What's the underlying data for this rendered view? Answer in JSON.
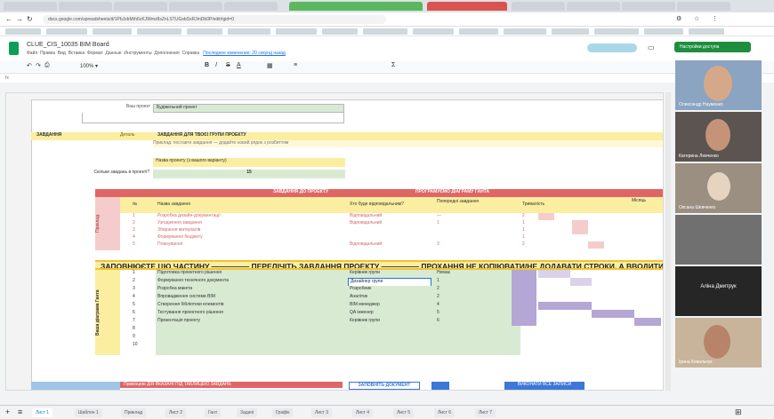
{
  "browser": {
    "url": "docs.google.com/spreadsheets/d/1PbJxbMrh6cKJWmz8sZnLSTUGsbSxRJmDb0P/edit#gid=0",
    "window_title": "Google Sheets"
  },
  "doc": {
    "title": "CLUE_CIS_10035 BIM Board",
    "menu": [
      "Файл",
      "Правка",
      "Вид",
      "Вставка",
      "Формат",
      "Данные",
      "Инструменты",
      "Дополнения",
      "Справка"
    ],
    "menu_note": "Последнее изменение: 20 секунд назад",
    "cell_ref": "",
    "share_label": "Настройки доступа"
  },
  "sheet": {
    "top_label": "Ваш проект",
    "top_value": "Будівельний проект",
    "section_label": "ЗАВДАННЯ",
    "section_note": "Деталь",
    "section_header": "ЗАВДАННЯ ДЛЯ ТВОЄЇ ГРУПИ ПРОЕКТУ",
    "section_sub": "Приклад: поставте завдання — додайте новий рядок з розбиттям",
    "prompt_label": "Назва проекту (з вашого варіанту)",
    "metric_label": "Скільки завдань в проекті?",
    "metric_value": "15",
    "red_header_left": "ЗАВДАННЯ ДО ПРОЕКТУ",
    "red_header_right": "ПРОГРАМУЄМО ДІАГРАМУ ГАНТА",
    "table_headers": [
      "№",
      "Назва завдання",
      "Хто буде відповідальним?",
      "Попередні завдання",
      "Тривалість",
      "Місяць"
    ],
    "example_label": "Приклад",
    "example_rows": [
      {
        "n": "1",
        "task": "Розробка дизайн-документації",
        "owner": "Відповідальний",
        "dep": "—",
        "dur": "2"
      },
      {
        "n": "2",
        "task": "Узгодження завдання",
        "owner": "Відповідальний",
        "dep": "1",
        "dur": "1"
      },
      {
        "n": "3",
        "task": "Збирання матеріалів",
        "owner": "",
        "dep": "",
        "dur": "1"
      },
      {
        "n": "4",
        "task": "Формування бюджету",
        "owner": "",
        "dep": "",
        "dur": "1"
      },
      {
        "n": "5",
        "task": "Планування",
        "owner": "Відповідальний",
        "dep": "3",
        "dur": "2"
      }
    ],
    "yellow_banner": "ЗАПОВНЮЄТЕ ЦЮ ЧАСТИНУ ————— ПЕРЕЛІЧІТЬ ЗАВДАННЯ ПРОЕКТУ ————— ПРОХАННЯ НЕ КОПІЮВАТИ/НЕ ДОДАВАТИ СТРОКИ. А ВВОДИТИ",
    "main_label": "Ваша діаграма Ганта",
    "main_rows": [
      {
        "n": "1",
        "task": "Підготовка проектного рішення",
        "owner": "Керівник групи",
        "dep": "Немає",
        "dur": "3"
      },
      {
        "n": "2",
        "task": "Формування технічного документа",
        "owner": "Дизайнер групи",
        "dep": "1",
        "dur": "2"
      },
      {
        "n": "3",
        "task": "Розробка макета",
        "owner": "Розробник",
        "dep": "2",
        "dur": "4"
      },
      {
        "n": "4",
        "task": "Впровадження системи BIM",
        "owner": "Аналітик",
        "dep": "2",
        "dur": "2"
      },
      {
        "n": "5",
        "task": "Створення бібліотеки елементів",
        "owner": "BIM менеджер",
        "dep": "4",
        "dur": "3"
      },
      {
        "n": "6",
        "task": "Тестування проектного рішення",
        "owner": "QA інженер",
        "dep": "5",
        "dur": "2"
      },
      {
        "n": "7",
        "task": "Презентація проекту",
        "owner": "Керівник групи",
        "dep": "6",
        "dur": "1"
      },
      {
        "n": "8",
        "task": "",
        "owner": "",
        "dep": "",
        "dur": ""
      },
      {
        "n": "9",
        "task": "",
        "owner": "",
        "dep": "",
        "dur": ""
      },
      {
        "n": "10",
        "task": "",
        "owner": "",
        "dep": "",
        "dur": ""
      }
    ],
    "bottom_left": "Прикінцеві ДІЯ ВКАЗАНІ ПІД ТАБЛИЦЕЮ ЗАВДАНЬ",
    "bottom_btn1": "ЗАПОВНІТЬ ДОКУМЕНТ",
    "bottom_btn2": "ВИКОНАТИ ВСЕ ЗАПИСИ"
  },
  "sheet_tabs": [
    "Лист 1",
    "Шаблон 1",
    "Приклад",
    "Лист 2",
    "Гант",
    "Задачі",
    "Графік",
    "Лист 3",
    "Лист 4",
    "Лист 5",
    "Лист 6",
    "Лист 7"
  ],
  "participants": [
    {
      "name": "Олександр Науменко",
      "bg": "#8aa4c2"
    },
    {
      "name": "Катерина Левченко",
      "bg": "#5b5450"
    },
    {
      "name": "Оксана Шевченко",
      "bg": "#9a8f80"
    },
    {
      "name": "",
      "bg": "#707070"
    },
    {
      "name": "Аліна Дмитрук",
      "bg": "#262626"
    },
    {
      "name": "Ірина Ковальчук",
      "bg": "#c8b49a"
    }
  ],
  "colors": {
    "sheets_green": "#0f9d58",
    "banner_yellow": "#f1c232",
    "header_red": "#e06666",
    "gantt_purple": "#b4a7d6"
  }
}
